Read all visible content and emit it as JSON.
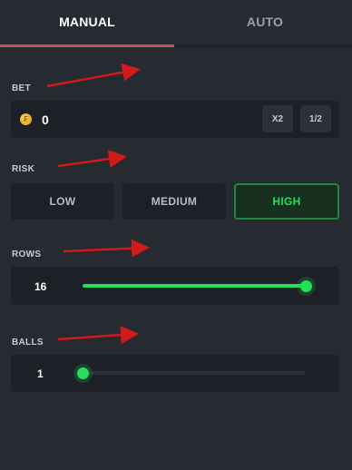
{
  "tabs": {
    "manual": "MANUAL",
    "auto": "AUTO"
  },
  "bet": {
    "label": "BET",
    "value": "0",
    "coin_icon": "coin-icon",
    "double_label": "X2",
    "half_label": "1/2"
  },
  "risk": {
    "label": "RISK",
    "options": [
      "LOW",
      "MEDIUM",
      "HIGH"
    ],
    "selected": "HIGH"
  },
  "rows": {
    "label": "ROWS",
    "value": "16",
    "fraction": 1.0
  },
  "balls": {
    "label": "BALLS",
    "value": "1",
    "fraction": 0.0
  },
  "colors": {
    "accent": "#22e05a",
    "tab_active_line": "#c8564f",
    "annotation_arrow": "#d11a1a"
  }
}
